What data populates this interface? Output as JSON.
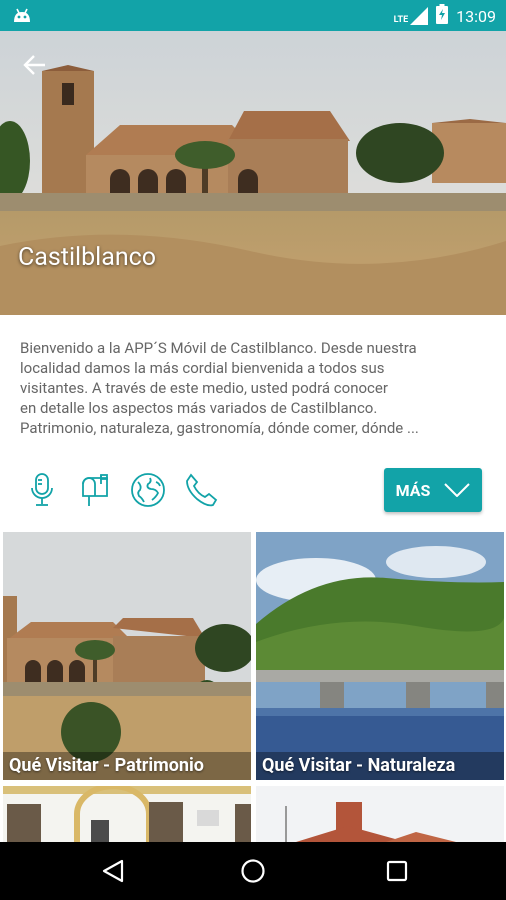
{
  "status_bar": {
    "app_icon": "android-icon",
    "network": "LTE",
    "time": "13:09"
  },
  "header": {
    "title": "Castilblanco",
    "back_icon": "arrow-back-icon"
  },
  "description": {
    "lines": [
      "Bienvenido a la APP´S Móvil de Castilblanco. Desde nuestra",
      "localidad damos la más cordial bienvenida a todos sus",
      "visitantes. A través de este medio, usted podrá conocer",
      "en detalle los aspectos más variados de Castilblanco.",
      "Patrimonio, naturaleza, gastronomía, dónde comer, dónde ..."
    ]
  },
  "actions": {
    "icons": [
      "microphone-icon",
      "mailbox-icon",
      "globe-icon",
      "phone-icon"
    ],
    "more_label": "MÁS"
  },
  "tiles": [
    {
      "label": "Qué Visitar - Patrimonio"
    },
    {
      "label": "Qué Visitar - Naturaleza"
    },
    {
      "label": ""
    },
    {
      "label": ""
    }
  ],
  "colors": {
    "accent": "#12a3a8",
    "nav_bar": "#000000"
  }
}
